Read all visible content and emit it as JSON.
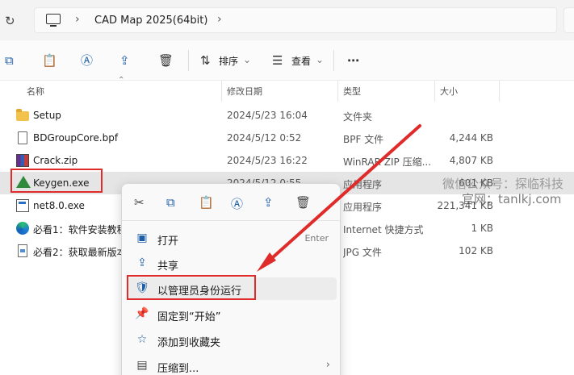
{
  "address": {
    "path": "CAD Map 2025(64bit)"
  },
  "toolbar": {
    "sort_label": "排序",
    "view_label": "查看"
  },
  "columns": {
    "name": "名称",
    "modified": "修改日期",
    "type": "类型",
    "size": "大小"
  },
  "files": [
    {
      "name": "Setup",
      "date": "2024/5/23 16:04",
      "type": "文件夹",
      "size": "",
      "icon": "folder-icon"
    },
    {
      "name": "BDGroupCore.bpf",
      "date": "2024/5/12 0:52",
      "type": "BPF 文件",
      "size": "4,244 KB",
      "icon": "document-icon"
    },
    {
      "name": "Crack.zip",
      "date": "2024/5/23 16:22",
      "type": "WinRAR ZIP 压缩...",
      "size": "4,807 KB",
      "icon": "winrar-icon"
    },
    {
      "name": "Keygen.exe",
      "date": "2024/5/12 0:55",
      "type": "应用程序",
      "size": "601 KB",
      "icon": "keygen-icon"
    },
    {
      "name": "net8.0.exe",
      "date": "",
      "type": "应用程序",
      "size": "221,341 KB",
      "icon": "exe-icon"
    },
    {
      "name": "必看1：软件安装教程",
      "date": "",
      "type": "Internet 快捷方式",
      "size": "1 KB",
      "icon": "edge-icon"
    },
    {
      "name": "必看2：获取最新版本",
      "date": "",
      "type": "JPG 文件",
      "size": "102 KB",
      "icon": "jpg-icon"
    }
  ],
  "watermark": {
    "line1": "微信公众号：探临科技",
    "line2": "官网：tanlkj.com"
  },
  "context_menu": {
    "items": [
      {
        "label": "打开",
        "shortcut": "Enter",
        "icon": "open-icon"
      },
      {
        "label": "共享",
        "shortcut": "",
        "icon": "share-icon"
      },
      {
        "label": "以管理员身份运行",
        "shortcut": "",
        "icon": "admin-shield-icon"
      },
      {
        "label": "固定到“开始”",
        "shortcut": "",
        "icon": "pin-icon"
      },
      {
        "label": "添加到收藏夹",
        "shortcut": "",
        "icon": "star-icon"
      },
      {
        "label": "压缩到...",
        "shortcut": "",
        "icon": "compress-icon"
      }
    ]
  },
  "colors": {
    "highlight_red": "#e02b2b",
    "accent_blue": "#1f5fa8",
    "row_hover": "#e5e5e5"
  }
}
